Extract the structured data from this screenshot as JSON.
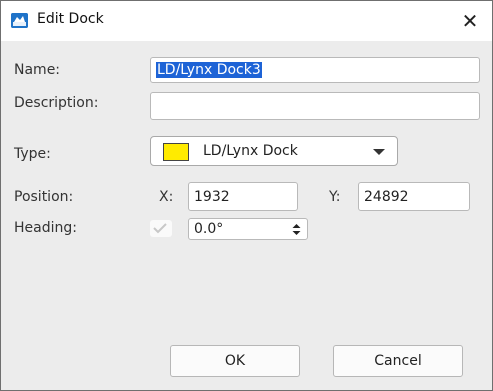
{
  "window": {
    "title": "Edit Dock",
    "close_glyph": "✕",
    "app_icon": "dock-app-icon"
  },
  "form": {
    "name_label": "Name:",
    "name_value": "LD/Lynx Dock3",
    "description_label": "Description:",
    "description_value": "",
    "type_label": "Type:",
    "type_value": "LD/Lynx Dock",
    "type_color": "#ffeb00",
    "position_label": "Position:",
    "x_label": "X:",
    "x_value": "1932",
    "y_label": "Y:",
    "y_value": "24892",
    "heading_label": "Heading:",
    "heading_value": "0.0°",
    "heading_checked": true
  },
  "buttons": {
    "ok_label": "OK",
    "cancel_label": "Cancel"
  },
  "colors": {
    "selection": "#1d63d6",
    "dialog_background": "#ececec"
  }
}
